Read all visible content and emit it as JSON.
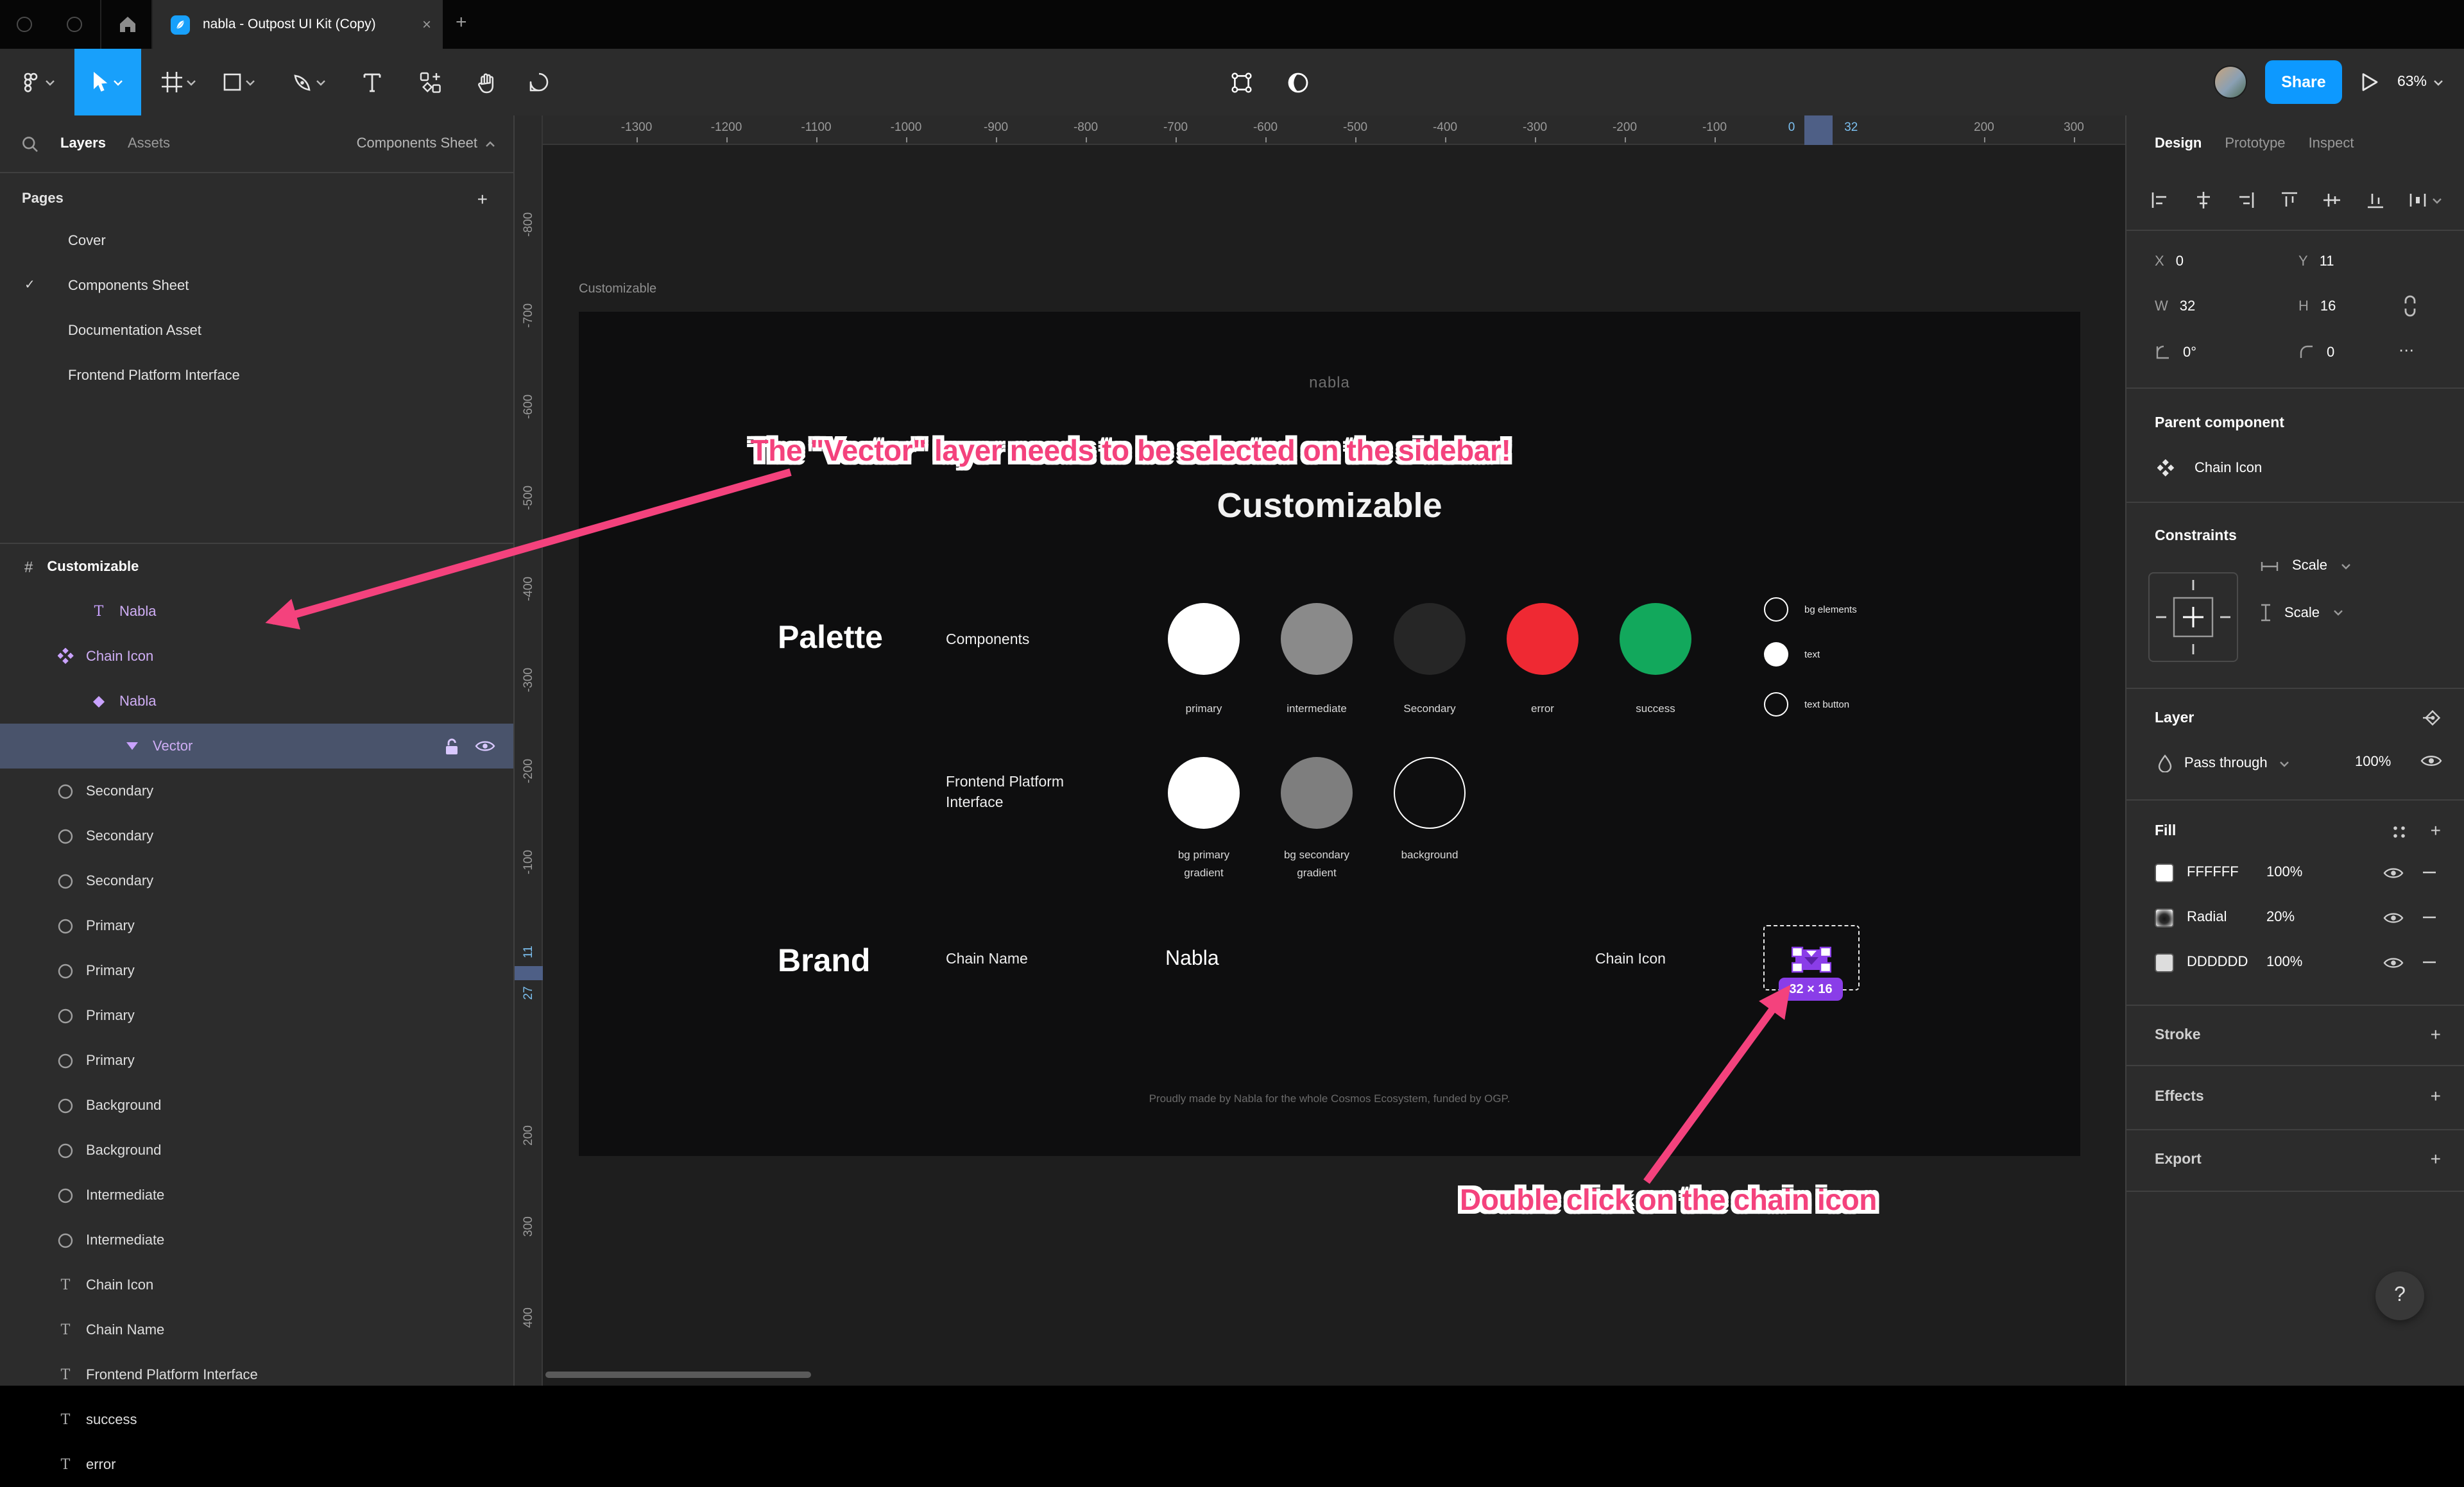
{
  "colors": {
    "accent_blue": "#18a0fb",
    "annotation_pink": "#f4427d",
    "selection_row": "#49536b",
    "badge_purple": "#8a3de8",
    "ruler_blue_text": "#7cc0f0",
    "ruler_selection": "#4e5f86"
  },
  "window": {
    "tab_title": "nabla - Outpost UI Kit (Copy)",
    "close_label": "×",
    "new_tab_label": "+"
  },
  "toolbar": {
    "share_label": "Share",
    "zoom_level": "63%"
  },
  "sidebar": {
    "tabs": {
      "layers": "Layers",
      "assets": "Assets"
    },
    "page_selector": "Components Sheet",
    "pages_header": "Pages",
    "pages_add": "+",
    "pages": [
      {
        "label": "Cover",
        "current": false
      },
      {
        "label": "Components Sheet",
        "current": true
      },
      {
        "label": "Documentation Asset",
        "current": false
      },
      {
        "label": "Frontend Platform Interface",
        "current": false
      }
    ],
    "check_glyph": "✓",
    "section_hash": "#",
    "section_label": "Customizable",
    "layers": [
      {
        "type": "text",
        "label": "Nabla",
        "indent": 2,
        "purple": true,
        "selected": false
      },
      {
        "type": "component",
        "label": "Chain Icon",
        "indent": 1,
        "purple": true,
        "selected": false
      },
      {
        "type": "instance",
        "label": "Nabla",
        "indent": 2,
        "purple": true,
        "selected": false
      },
      {
        "type": "vector",
        "label": "Vector",
        "indent": 3,
        "purple": true,
        "selected": true
      },
      {
        "type": "ellipse",
        "label": "Secondary",
        "indent": 1,
        "purple": false,
        "selected": false
      },
      {
        "type": "ellipse",
        "label": "Secondary",
        "indent": 1,
        "purple": false,
        "selected": false
      },
      {
        "type": "ellipse",
        "label": "Secondary",
        "indent": 1,
        "purple": false,
        "selected": false
      },
      {
        "type": "ellipse",
        "label": "Primary",
        "indent": 1,
        "purple": false,
        "selected": false
      },
      {
        "type": "ellipse",
        "label": "Primary",
        "indent": 1,
        "purple": false,
        "selected": false
      },
      {
        "type": "ellipse",
        "label": "Primary",
        "indent": 1,
        "purple": false,
        "selected": false
      },
      {
        "type": "ellipse",
        "label": "Primary",
        "indent": 1,
        "purple": false,
        "selected": false
      },
      {
        "type": "ellipse",
        "label": "Background",
        "indent": 1,
        "purple": false,
        "selected": false
      },
      {
        "type": "ellipse",
        "label": "Background",
        "indent": 1,
        "purple": false,
        "selected": false
      },
      {
        "type": "ellipse",
        "label": "Intermediate",
        "indent": 1,
        "purple": false,
        "selected": false
      },
      {
        "type": "ellipse",
        "label": "Intermediate",
        "indent": 1,
        "purple": false,
        "selected": false
      },
      {
        "type": "text",
        "label": "Chain Icon",
        "indent": 1,
        "purple": false,
        "selected": false
      },
      {
        "type": "text",
        "label": "Chain Name",
        "indent": 1,
        "purple": false,
        "selected": false
      },
      {
        "type": "text",
        "label": "Frontend Platform Interface",
        "indent": 1,
        "purple": false,
        "selected": false
      },
      {
        "type": "text",
        "label": "success",
        "indent": 1,
        "purple": false,
        "selected": false
      },
      {
        "type": "text",
        "label": "error",
        "indent": 1,
        "purple": false,
        "selected": false
      }
    ]
  },
  "rulers": {
    "horizontal_ticks": [
      -1300,
      -1200,
      -1100,
      -1000,
      -900,
      -800,
      -700,
      -600,
      -500,
      -400,
      -300,
      -200,
      -100,
      200,
      300
    ],
    "horizontal_selection_labels": [
      "0",
      "32"
    ],
    "vertical_ticks": [
      -800,
      -700,
      -600,
      -500,
      -400,
      -300,
      -200,
      -100,
      200,
      300,
      400
    ],
    "vertical_selection_labels": [
      "11",
      "27"
    ]
  },
  "canvas": {
    "frame_label": "Customizable",
    "logo": "nabla",
    "heading": "Customizable",
    "palette_header": "Palette",
    "components_label": "Components",
    "palette_items": [
      {
        "label": "primary",
        "color": "#ffffff"
      },
      {
        "label": "intermediate",
        "color": "#8a8a8a"
      },
      {
        "label": "Secondary",
        "color": "#262626"
      },
      {
        "label": "error",
        "color": "#ef2933"
      },
      {
        "label": "success",
        "color": "#12a85c"
      }
    ],
    "mini_items": [
      {
        "label": "bg elements",
        "style": "outline"
      },
      {
        "label": "text",
        "style": "fill"
      },
      {
        "label": "text button",
        "style": "outline"
      }
    ],
    "fpi_label": "Frontend Platform Interface",
    "fpi_items": [
      {
        "label": "bg primary\ngradient",
        "color": "#ffffff"
      },
      {
        "label": "bg secondary\ngradient",
        "color": "#7e7e7e"
      },
      {
        "label": "background",
        "color": "outline"
      }
    ],
    "brand_header": "Brand",
    "chain_name_label": "Chain Name",
    "chain_name_value": "Nabla",
    "chain_icon_label": "Chain Icon",
    "size_badge": "32 × 16",
    "footer": "Proudly made by Nabla for the whole Cosmos Ecosystem, funded by OGP."
  },
  "annotations": {
    "first": "The \"Vector\" layer needs to be selected on the sidebar!",
    "second": "Double click on the chain icon"
  },
  "right_panel": {
    "tabs": {
      "design": "Design",
      "prototype": "Prototype",
      "inspect": "Inspect"
    },
    "x_label": "X",
    "x_value": "0",
    "y_label": "Y",
    "y_value": "11",
    "w_label": "W",
    "w_value": "32",
    "h_label": "H",
    "h_value": "16",
    "rotation_value": "0°",
    "radius_value": "0",
    "more_label": "⋯",
    "parent_component_header": "Parent component",
    "parent_component_name": "Chain Icon",
    "constraints_header": "Constraints",
    "h_constraint": "Scale",
    "v_constraint": "Scale",
    "layer_header": "Layer",
    "blend_mode": "Pass through",
    "layer_opacity": "100%",
    "fill_header": "Fill",
    "fill_add": "+",
    "fills": [
      {
        "name": "FFFFFF",
        "value": "100%",
        "swatch": "solid",
        "hex": "#ffffff"
      },
      {
        "name": "Radial",
        "value": "20%",
        "swatch": "radial",
        "hex": ""
      },
      {
        "name": "DDDDDD",
        "value": "100%",
        "swatch": "solid",
        "hex": "#dddddd"
      }
    ],
    "stroke_header": "Stroke",
    "stroke_add": "+",
    "effects_header": "Effects",
    "effects_add": "+",
    "export_header": "Export",
    "export_add": "+",
    "help_label": "?"
  }
}
